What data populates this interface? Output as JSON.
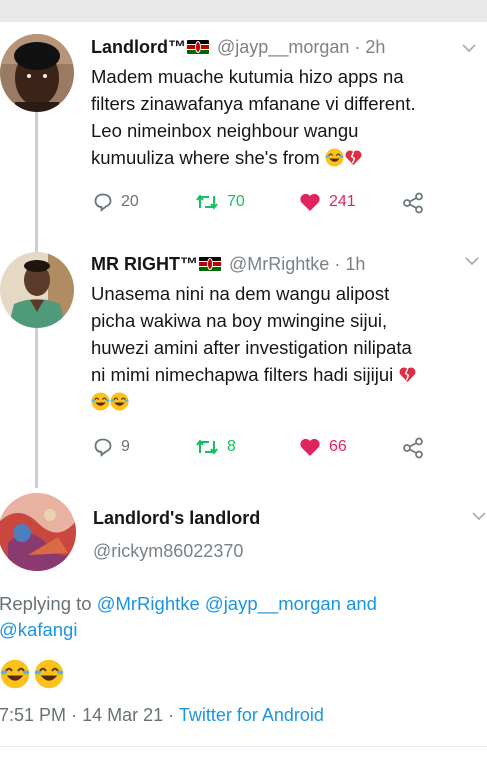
{
  "tweet1": {
    "name": "Landlord™",
    "handle": "@jayp__morgan",
    "time": "· 2h",
    "lines": [
      "Madem muache kutumia hizo apps na",
      "filters zinawafanya mfanane vi different.",
      "Leo nimeinbox neighbour wangu",
      "kumuuliza where she's from"
    ],
    "replies": "20",
    "retweets": "70",
    "likes": "241"
  },
  "tweet2": {
    "name": "MR RIGHT™",
    "handle": "@MrRightke",
    "time": "· 1h",
    "lines": [
      "Unasema nini na dem wangu alipost",
      "picha wakiwa na boy mwingine sijui,",
      "huwezi amini after investigation nilipata",
      "ni mimi nimechapwa filters hadi sijijui"
    ],
    "replies": "9",
    "retweets": "8",
    "likes": "66"
  },
  "tweet3": {
    "name": "Landlord's landlord",
    "handle": "@rickym86022370",
    "replying_prefix": "Replying to",
    "mentions": [
      "@MrRightke",
      "@jayp__morgan",
      "@kafangi"
    ],
    "and_word": "and",
    "time": "7:51 PM",
    "date": "14 Mar 21",
    "separator": "·",
    "source": "Twitter for Android"
  },
  "colors": {
    "link": "#1b95e0",
    "retweet": "#17bf63",
    "like": "#e0245e",
    "muted": "#687176"
  },
  "icons": [
    "reply-icon",
    "retweet-icon",
    "heart-icon",
    "share-icon",
    "chevron-down-icon",
    "kenya-flag-icon",
    "laughing-emoji-icon",
    "broken-heart-emoji-icon"
  ]
}
